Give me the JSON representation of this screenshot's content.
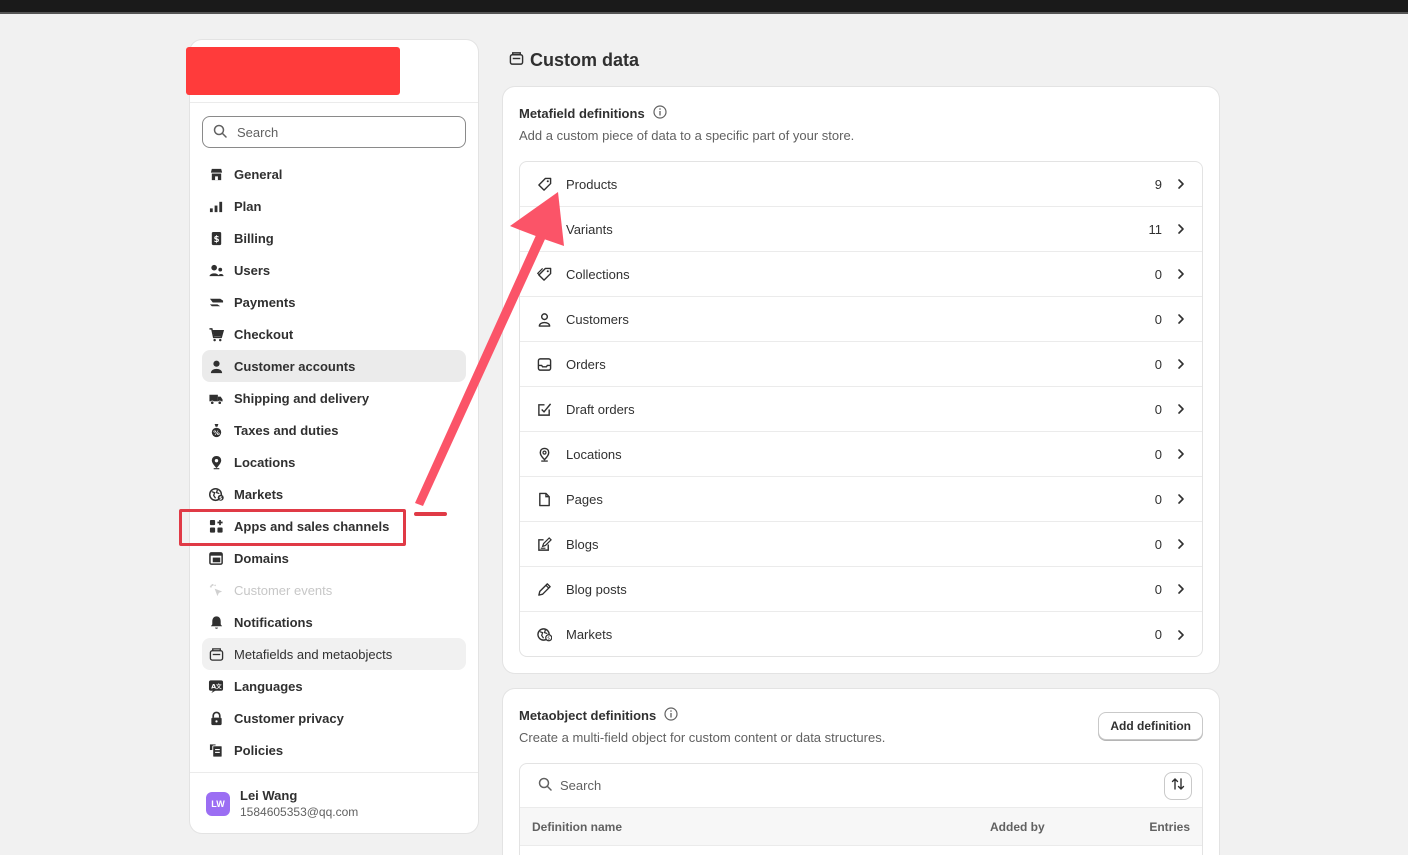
{
  "sidebar": {
    "search_placeholder": "Search",
    "items": [
      {
        "label": "General",
        "icon": "store-icon"
      },
      {
        "label": "Plan",
        "icon": "plan-icon"
      },
      {
        "label": "Billing",
        "icon": "billing-icon"
      },
      {
        "label": "Users",
        "icon": "users-icon"
      },
      {
        "label": "Payments",
        "icon": "payments-icon"
      },
      {
        "label": "Checkout",
        "icon": "cart-icon"
      },
      {
        "label": "Customer accounts",
        "icon": "person-icon"
      },
      {
        "label": "Shipping and delivery",
        "icon": "truck-icon"
      },
      {
        "label": "Taxes and duties",
        "icon": "tax-icon"
      },
      {
        "label": "Locations",
        "icon": "location-icon"
      },
      {
        "label": "Markets",
        "icon": "globe-icon"
      },
      {
        "label": "Apps and sales channels",
        "icon": "apps-icon"
      },
      {
        "label": "Domains",
        "icon": "domains-icon"
      },
      {
        "label": "Customer events",
        "icon": "cursor-icon"
      },
      {
        "label": "Notifications",
        "icon": "bell-icon"
      },
      {
        "label": "Metafields and metaobjects",
        "icon": "metafields-icon"
      },
      {
        "label": "Languages",
        "icon": "language-icon"
      },
      {
        "label": "Customer privacy",
        "icon": "lock-icon"
      },
      {
        "label": "Policies",
        "icon": "policies-icon"
      }
    ],
    "user": {
      "initials": "LW",
      "name": "Lei Wang",
      "email": "1584605353@qq.com"
    }
  },
  "page": {
    "title": "Custom data"
  },
  "metafields": {
    "heading": "Metafield definitions",
    "description": "Add a custom piece of data to a specific part of your store.",
    "rows": [
      {
        "label": "Products",
        "count": "9",
        "icon": "tag-icon"
      },
      {
        "label": "Variants",
        "count": "11",
        "icon": "variant-icon"
      },
      {
        "label": "Collections",
        "count": "0",
        "icon": "collection-icon"
      },
      {
        "label": "Customers",
        "count": "0",
        "icon": "person-icon"
      },
      {
        "label": "Orders",
        "count": "0",
        "icon": "inbox-icon"
      },
      {
        "label": "Draft orders",
        "count": "0",
        "icon": "draft-order-icon"
      },
      {
        "label": "Locations",
        "count": "0",
        "icon": "location-icon"
      },
      {
        "label": "Pages",
        "count": "0",
        "icon": "page-icon"
      },
      {
        "label": "Blogs",
        "count": "0",
        "icon": "blog-icon"
      },
      {
        "label": "Blog posts",
        "count": "0",
        "icon": "pencil-icon"
      },
      {
        "label": "Markets",
        "count": "0",
        "icon": "globe-icon"
      }
    ]
  },
  "metaobjects": {
    "heading": "Metaobject definitions",
    "description": "Create a multi-field object for custom content or data structures.",
    "add_button": "Add definition",
    "search_placeholder": "Search",
    "columns": {
      "name": "Definition name",
      "added_by": "Added by",
      "entries": "Entries"
    }
  },
  "colors": {
    "accent_red": "#e03a46",
    "logo_red": "#ff3b3b",
    "avatar": "#9b6ef3"
  }
}
